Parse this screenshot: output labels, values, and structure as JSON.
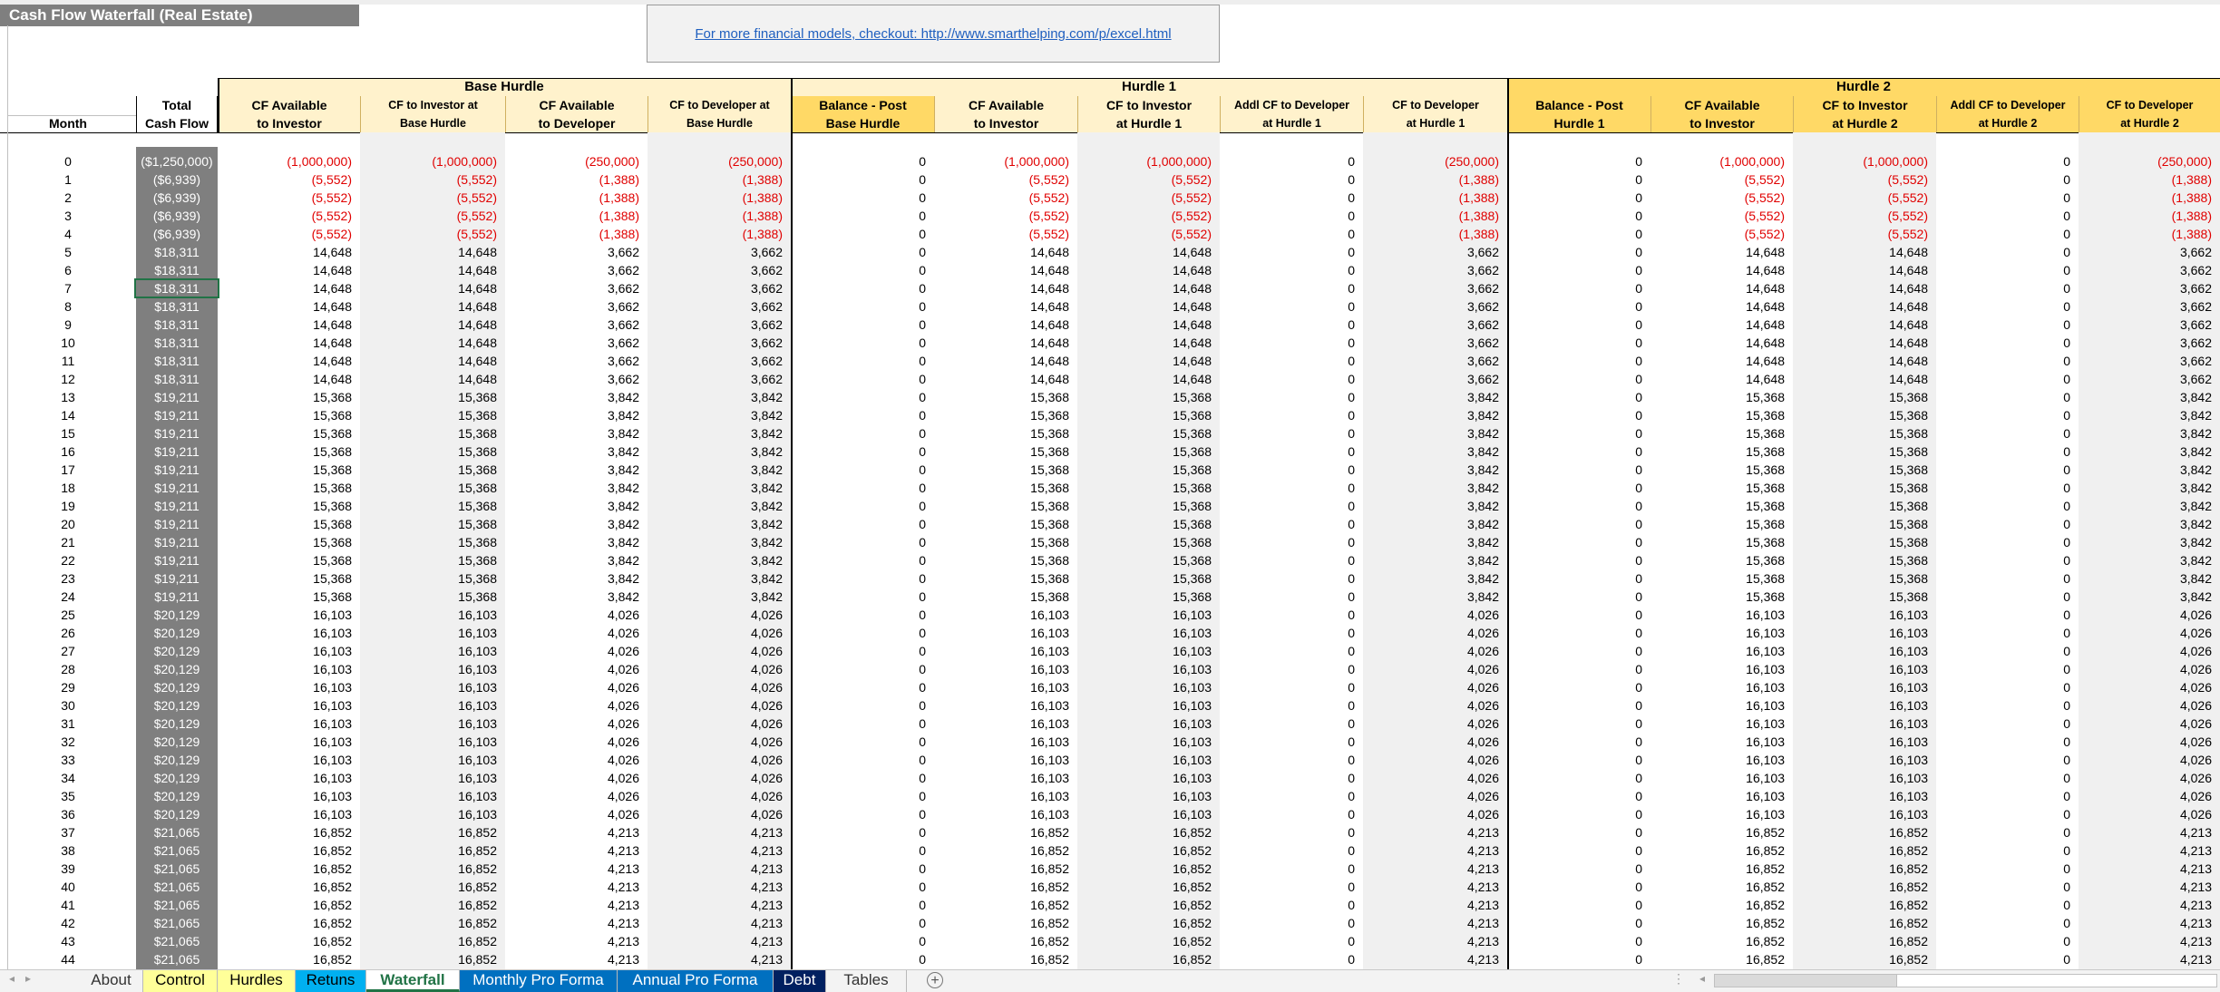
{
  "sheet_title": "Cash Flow Waterfall (Real Estate)",
  "link_text": "For more financial models, checkout: http://www.smarthelping.com/p/excel.html",
  "groups": [
    "Base Hurdle",
    "Hurdle 1",
    "Hurdle 2"
  ],
  "month_header": "Month",
  "total_header_1": "Total",
  "total_header_2": "Cash Flow",
  "columns": [
    {
      "l1": "CF Available",
      "l2": "to Investor"
    },
    {
      "l1": "CF to Investor at",
      "l2": "Base Hurdle"
    },
    {
      "l1": "CF Available",
      "l2": "to Developer"
    },
    {
      "l1": "CF to Developer at",
      "l2": "Base Hurdle"
    },
    {
      "l1": "Balance - Post",
      "l2": "Base Hurdle"
    },
    {
      "l1": "CF Available",
      "l2": "to Investor"
    },
    {
      "l1": "CF to Investor",
      "l2": "at Hurdle 1"
    },
    {
      "l1": "Addl CF to Developer",
      "l2": "at Hurdle 1"
    },
    {
      "l1": "CF to Developer",
      "l2": "at Hurdle 1"
    },
    {
      "l1": "Balance - Post",
      "l2": "Hurdle 1"
    },
    {
      "l1": "CF Available",
      "l2": "to Investor"
    },
    {
      "l1": "CF to Investor",
      "l2": "at Hurdle 2"
    },
    {
      "l1": "Addl CF to Developer",
      "l2": "at Hurdle 2"
    },
    {
      "l1": "CF to Developer",
      "l2": "at Hurdle 2"
    }
  ],
  "rows": [
    {
      "m": "0",
      "t": "($1,250,000)",
      "v": [
        "(1,000,000)",
        "(1,000,000)",
        "(250,000)",
        "(250,000)",
        "0",
        "(1,000,000)",
        "(1,000,000)",
        "0",
        "(250,000)",
        "0",
        "(1,000,000)",
        "(1,000,000)",
        "0",
        "(250,000)"
      ]
    },
    {
      "m": "1",
      "t": "($6,939)",
      "v": [
        "(5,552)",
        "(5,552)",
        "(1,388)",
        "(1,388)",
        "0",
        "(5,552)",
        "(5,552)",
        "0",
        "(1,388)",
        "0",
        "(5,552)",
        "(5,552)",
        "0",
        "(1,388)"
      ]
    },
    {
      "m": "2",
      "t": "($6,939)",
      "v": [
        "(5,552)",
        "(5,552)",
        "(1,388)",
        "(1,388)",
        "0",
        "(5,552)",
        "(5,552)",
        "0",
        "(1,388)",
        "0",
        "(5,552)",
        "(5,552)",
        "0",
        "(1,388)"
      ]
    },
    {
      "m": "3",
      "t": "($6,939)",
      "v": [
        "(5,552)",
        "(5,552)",
        "(1,388)",
        "(1,388)",
        "0",
        "(5,552)",
        "(5,552)",
        "0",
        "(1,388)",
        "0",
        "(5,552)",
        "(5,552)",
        "0",
        "(1,388)"
      ]
    },
    {
      "m": "4",
      "t": "($6,939)",
      "v": [
        "(5,552)",
        "(5,552)",
        "(1,388)",
        "(1,388)",
        "0",
        "(5,552)",
        "(5,552)",
        "0",
        "(1,388)",
        "0",
        "(5,552)",
        "(5,552)",
        "0",
        "(1,388)"
      ]
    },
    {
      "m": "5",
      "t": "$18,311",
      "v": [
        "14,648",
        "14,648",
        "3,662",
        "3,662",
        "0",
        "14,648",
        "14,648",
        "0",
        "3,662",
        "0",
        "14,648",
        "14,648",
        "0",
        "3,662"
      ]
    },
    {
      "m": "6",
      "t": "$18,311",
      "v": [
        "14,648",
        "14,648",
        "3,662",
        "3,662",
        "0",
        "14,648",
        "14,648",
        "0",
        "3,662",
        "0",
        "14,648",
        "14,648",
        "0",
        "3,662"
      ]
    },
    {
      "m": "7",
      "t": "$18,311",
      "v": [
        "14,648",
        "14,648",
        "3,662",
        "3,662",
        "0",
        "14,648",
        "14,648",
        "0",
        "3,662",
        "0",
        "14,648",
        "14,648",
        "0",
        "3,662"
      ]
    },
    {
      "m": "8",
      "t": "$18,311",
      "v": [
        "14,648",
        "14,648",
        "3,662",
        "3,662",
        "0",
        "14,648",
        "14,648",
        "0",
        "3,662",
        "0",
        "14,648",
        "14,648",
        "0",
        "3,662"
      ]
    },
    {
      "m": "9",
      "t": "$18,311",
      "v": [
        "14,648",
        "14,648",
        "3,662",
        "3,662",
        "0",
        "14,648",
        "14,648",
        "0",
        "3,662",
        "0",
        "14,648",
        "14,648",
        "0",
        "3,662"
      ]
    },
    {
      "m": "10",
      "t": "$18,311",
      "v": [
        "14,648",
        "14,648",
        "3,662",
        "3,662",
        "0",
        "14,648",
        "14,648",
        "0",
        "3,662",
        "0",
        "14,648",
        "14,648",
        "0",
        "3,662"
      ]
    },
    {
      "m": "11",
      "t": "$18,311",
      "v": [
        "14,648",
        "14,648",
        "3,662",
        "3,662",
        "0",
        "14,648",
        "14,648",
        "0",
        "3,662",
        "0",
        "14,648",
        "14,648",
        "0",
        "3,662"
      ]
    },
    {
      "m": "12",
      "t": "$18,311",
      "v": [
        "14,648",
        "14,648",
        "3,662",
        "3,662",
        "0",
        "14,648",
        "14,648",
        "0",
        "3,662",
        "0",
        "14,648",
        "14,648",
        "0",
        "3,662"
      ]
    },
    {
      "m": "13",
      "t": "$19,211",
      "v": [
        "15,368",
        "15,368",
        "3,842",
        "3,842",
        "0",
        "15,368",
        "15,368",
        "0",
        "3,842",
        "0",
        "15,368",
        "15,368",
        "0",
        "3,842"
      ]
    },
    {
      "m": "14",
      "t": "$19,211",
      "v": [
        "15,368",
        "15,368",
        "3,842",
        "3,842",
        "0",
        "15,368",
        "15,368",
        "0",
        "3,842",
        "0",
        "15,368",
        "15,368",
        "0",
        "3,842"
      ]
    },
    {
      "m": "15",
      "t": "$19,211",
      "v": [
        "15,368",
        "15,368",
        "3,842",
        "3,842",
        "0",
        "15,368",
        "15,368",
        "0",
        "3,842",
        "0",
        "15,368",
        "15,368",
        "0",
        "3,842"
      ]
    },
    {
      "m": "16",
      "t": "$19,211",
      "v": [
        "15,368",
        "15,368",
        "3,842",
        "3,842",
        "0",
        "15,368",
        "15,368",
        "0",
        "3,842",
        "0",
        "15,368",
        "15,368",
        "0",
        "3,842"
      ]
    },
    {
      "m": "17",
      "t": "$19,211",
      "v": [
        "15,368",
        "15,368",
        "3,842",
        "3,842",
        "0",
        "15,368",
        "15,368",
        "0",
        "3,842",
        "0",
        "15,368",
        "15,368",
        "0",
        "3,842"
      ]
    },
    {
      "m": "18",
      "t": "$19,211",
      "v": [
        "15,368",
        "15,368",
        "3,842",
        "3,842",
        "0",
        "15,368",
        "15,368",
        "0",
        "3,842",
        "0",
        "15,368",
        "15,368",
        "0",
        "3,842"
      ]
    },
    {
      "m": "19",
      "t": "$19,211",
      "v": [
        "15,368",
        "15,368",
        "3,842",
        "3,842",
        "0",
        "15,368",
        "15,368",
        "0",
        "3,842",
        "0",
        "15,368",
        "15,368",
        "0",
        "3,842"
      ]
    },
    {
      "m": "20",
      "t": "$19,211",
      "v": [
        "15,368",
        "15,368",
        "3,842",
        "3,842",
        "0",
        "15,368",
        "15,368",
        "0",
        "3,842",
        "0",
        "15,368",
        "15,368",
        "0",
        "3,842"
      ]
    },
    {
      "m": "21",
      "t": "$19,211",
      "v": [
        "15,368",
        "15,368",
        "3,842",
        "3,842",
        "0",
        "15,368",
        "15,368",
        "0",
        "3,842",
        "0",
        "15,368",
        "15,368",
        "0",
        "3,842"
      ]
    },
    {
      "m": "22",
      "t": "$19,211",
      "v": [
        "15,368",
        "15,368",
        "3,842",
        "3,842",
        "0",
        "15,368",
        "15,368",
        "0",
        "3,842",
        "0",
        "15,368",
        "15,368",
        "0",
        "3,842"
      ]
    },
    {
      "m": "23",
      "t": "$19,211",
      "v": [
        "15,368",
        "15,368",
        "3,842",
        "3,842",
        "0",
        "15,368",
        "15,368",
        "0",
        "3,842",
        "0",
        "15,368",
        "15,368",
        "0",
        "3,842"
      ]
    },
    {
      "m": "24",
      "t": "$19,211",
      "v": [
        "15,368",
        "15,368",
        "3,842",
        "3,842",
        "0",
        "15,368",
        "15,368",
        "0",
        "3,842",
        "0",
        "15,368",
        "15,368",
        "0",
        "3,842"
      ]
    },
    {
      "m": "25",
      "t": "$20,129",
      "v": [
        "16,103",
        "16,103",
        "4,026",
        "4,026",
        "0",
        "16,103",
        "16,103",
        "0",
        "4,026",
        "0",
        "16,103",
        "16,103",
        "0",
        "4,026"
      ]
    },
    {
      "m": "26",
      "t": "$20,129",
      "v": [
        "16,103",
        "16,103",
        "4,026",
        "4,026",
        "0",
        "16,103",
        "16,103",
        "0",
        "4,026",
        "0",
        "16,103",
        "16,103",
        "0",
        "4,026"
      ]
    },
    {
      "m": "27",
      "t": "$20,129",
      "v": [
        "16,103",
        "16,103",
        "4,026",
        "4,026",
        "0",
        "16,103",
        "16,103",
        "0",
        "4,026",
        "0",
        "16,103",
        "16,103",
        "0",
        "4,026"
      ]
    },
    {
      "m": "28",
      "t": "$20,129",
      "v": [
        "16,103",
        "16,103",
        "4,026",
        "4,026",
        "0",
        "16,103",
        "16,103",
        "0",
        "4,026",
        "0",
        "16,103",
        "16,103",
        "0",
        "4,026"
      ]
    },
    {
      "m": "29",
      "t": "$20,129",
      "v": [
        "16,103",
        "16,103",
        "4,026",
        "4,026",
        "0",
        "16,103",
        "16,103",
        "0",
        "4,026",
        "0",
        "16,103",
        "16,103",
        "0",
        "4,026"
      ]
    },
    {
      "m": "30",
      "t": "$20,129",
      "v": [
        "16,103",
        "16,103",
        "4,026",
        "4,026",
        "0",
        "16,103",
        "16,103",
        "0",
        "4,026",
        "0",
        "16,103",
        "16,103",
        "0",
        "4,026"
      ]
    },
    {
      "m": "31",
      "t": "$20,129",
      "v": [
        "16,103",
        "16,103",
        "4,026",
        "4,026",
        "0",
        "16,103",
        "16,103",
        "0",
        "4,026",
        "0",
        "16,103",
        "16,103",
        "0",
        "4,026"
      ]
    },
    {
      "m": "32",
      "t": "$20,129",
      "v": [
        "16,103",
        "16,103",
        "4,026",
        "4,026",
        "0",
        "16,103",
        "16,103",
        "0",
        "4,026",
        "0",
        "16,103",
        "16,103",
        "0",
        "4,026"
      ]
    },
    {
      "m": "33",
      "t": "$20,129",
      "v": [
        "16,103",
        "16,103",
        "4,026",
        "4,026",
        "0",
        "16,103",
        "16,103",
        "0",
        "4,026",
        "0",
        "16,103",
        "16,103",
        "0",
        "4,026"
      ]
    },
    {
      "m": "34",
      "t": "$20,129",
      "v": [
        "16,103",
        "16,103",
        "4,026",
        "4,026",
        "0",
        "16,103",
        "16,103",
        "0",
        "4,026",
        "0",
        "16,103",
        "16,103",
        "0",
        "4,026"
      ]
    },
    {
      "m": "35",
      "t": "$20,129",
      "v": [
        "16,103",
        "16,103",
        "4,026",
        "4,026",
        "0",
        "16,103",
        "16,103",
        "0",
        "4,026",
        "0",
        "16,103",
        "16,103",
        "0",
        "4,026"
      ]
    },
    {
      "m": "36",
      "t": "$20,129",
      "v": [
        "16,103",
        "16,103",
        "4,026",
        "4,026",
        "0",
        "16,103",
        "16,103",
        "0",
        "4,026",
        "0",
        "16,103",
        "16,103",
        "0",
        "4,026"
      ]
    },
    {
      "m": "37",
      "t": "$21,065",
      "v": [
        "16,852",
        "16,852",
        "4,213",
        "4,213",
        "0",
        "16,852",
        "16,852",
        "0",
        "4,213",
        "0",
        "16,852",
        "16,852",
        "0",
        "4,213"
      ]
    },
    {
      "m": "38",
      "t": "$21,065",
      "v": [
        "16,852",
        "16,852",
        "4,213",
        "4,213",
        "0",
        "16,852",
        "16,852",
        "0",
        "4,213",
        "0",
        "16,852",
        "16,852",
        "0",
        "4,213"
      ]
    },
    {
      "m": "39",
      "t": "$21,065",
      "v": [
        "16,852",
        "16,852",
        "4,213",
        "4,213",
        "0",
        "16,852",
        "16,852",
        "0",
        "4,213",
        "0",
        "16,852",
        "16,852",
        "0",
        "4,213"
      ]
    },
    {
      "m": "40",
      "t": "$21,065",
      "v": [
        "16,852",
        "16,852",
        "4,213",
        "4,213",
        "0",
        "16,852",
        "16,852",
        "0",
        "4,213",
        "0",
        "16,852",
        "16,852",
        "0",
        "4,213"
      ]
    },
    {
      "m": "41",
      "t": "$21,065",
      "v": [
        "16,852",
        "16,852",
        "4,213",
        "4,213",
        "0",
        "16,852",
        "16,852",
        "0",
        "4,213",
        "0",
        "16,852",
        "16,852",
        "0",
        "4,213"
      ]
    },
    {
      "m": "42",
      "t": "$21,065",
      "v": [
        "16,852",
        "16,852",
        "4,213",
        "4,213",
        "0",
        "16,852",
        "16,852",
        "0",
        "4,213",
        "0",
        "16,852",
        "16,852",
        "0",
        "4,213"
      ]
    },
    {
      "m": "43",
      "t": "$21,065",
      "v": [
        "16,852",
        "16,852",
        "4,213",
        "4,213",
        "0",
        "16,852",
        "16,852",
        "0",
        "4,213",
        "0",
        "16,852",
        "16,852",
        "0",
        "4,213"
      ]
    },
    {
      "m": "44",
      "t": "$21,065",
      "v": [
        "16,852",
        "16,852",
        "4,213",
        "4,213",
        "0",
        "16,852",
        "16,852",
        "0",
        "4,213",
        "0",
        "16,852",
        "16,852",
        "0",
        "4,213"
      ]
    }
  ],
  "tabs": [
    {
      "label": "About",
      "color": "#f3f3f3",
      "text": "#333333"
    },
    {
      "label": "Control",
      "color": "#ffff99",
      "text": "#000000"
    },
    {
      "label": "Hurdles",
      "color": "#ffff99",
      "text": "#000000"
    },
    {
      "label": "Retuns",
      "color": "#00b0f0",
      "text": "#000000"
    },
    {
      "label": "Waterfall",
      "color": "#ffffff",
      "text": "#217346"
    },
    {
      "label": "Monthly Pro Forma",
      "color": "#0070c0",
      "text": "#ffffff"
    },
    {
      "label": "Annual Pro Forma",
      "color": "#0070c0",
      "text": "#ffffff"
    },
    {
      "label": "Debt",
      "color": "#002060",
      "text": "#ffffff"
    },
    {
      "label": "Tables",
      "color": "#f3f3f3",
      "text": "#333333"
    }
  ],
  "active_tab": "Waterfall",
  "colors": {
    "header_light": "#fff2cc",
    "header_dark": "#ffd966",
    "total_fill": "#7f7f7f",
    "negative": "#e00000",
    "link": "#1f5fbf",
    "selection": "#217346",
    "gray_column": "#f0f0f0"
  },
  "icons": {
    "tab_nav_prev": "◂",
    "tab_nav_next": "▸",
    "add_sheet": "+",
    "more_options": "⋮",
    "scroll_left": "◂"
  }
}
